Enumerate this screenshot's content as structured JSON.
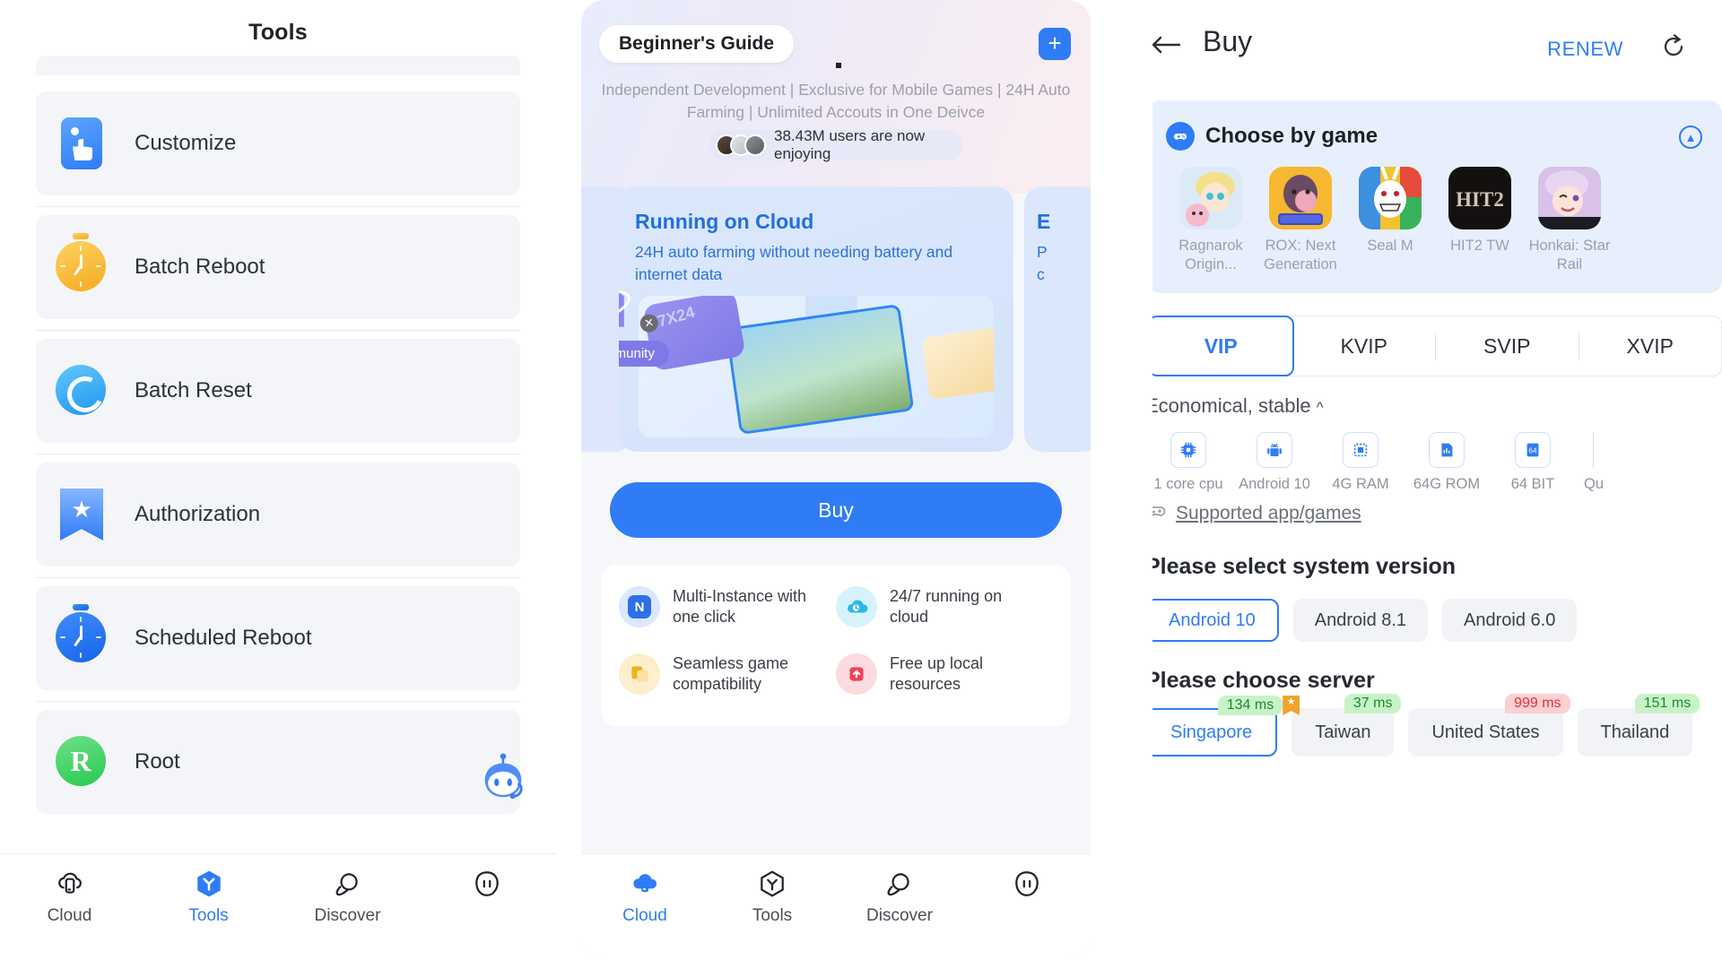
{
  "tools_panel": {
    "title": "Tools",
    "items": [
      {
        "label": "Customize",
        "icon": "customize-icon"
      },
      {
        "label": "Batch Reboot",
        "icon": "stopwatch-amber-icon"
      },
      {
        "label": "Batch Reset",
        "icon": "refresh-circle-icon"
      },
      {
        "label": "Authorization",
        "icon": "bookmark-star-icon"
      },
      {
        "label": "Scheduled Reboot",
        "icon": "stopwatch-blue-icon"
      },
      {
        "label": "Root",
        "icon": "root-icon"
      }
    ],
    "assistant_icon": "robot-assistant-icon",
    "bottom_nav": [
      {
        "label": "Cloud",
        "icon": "cloud-phone-icon",
        "active": false
      },
      {
        "label": "Tools",
        "icon": "tools-hex-icon",
        "active": true
      },
      {
        "label": "Discover",
        "icon": "planet-icon",
        "active": false
      },
      {
        "label": "",
        "icon": "profile-icon",
        "active": false
      }
    ]
  },
  "cloud_panel": {
    "guide_pill": "Beginner's Guide",
    "add_button": "+",
    "subtitle": "Independent Development | Exclusive for Mobile Games | 24H Auto Farming | Unlimited Accouts in One Deivce",
    "users_text": "38.43M users are now enjoying",
    "carousel": [
      {
        "title": "Running on Cloud",
        "desc": "24H auto farming without needing battery and internet data",
        "badge": "7X24",
        "tag": "Community"
      },
      {
        "title": "E",
        "desc_line1": "P",
        "desc_line2": "c"
      }
    ],
    "buy_button": "Buy",
    "features": [
      {
        "text": "Multi-Instance with one click",
        "icon": "multi-instance-icon",
        "color": "#2f6fe8",
        "bg": "#dbe8fd"
      },
      {
        "text": "24/7 running on cloud",
        "icon": "cloud-running-icon",
        "color": "#2bb7e8",
        "bg": "#d6f3fb"
      },
      {
        "text": "Seamless game compatibility",
        "icon": "seamless-game-icon",
        "color": "#f0b11f",
        "bg": "#fdeecd"
      },
      {
        "text": "Free up local resources",
        "icon": "free-resources-icon",
        "color": "#f2415a",
        "bg": "#fcdbe0"
      }
    ],
    "bottom_nav": [
      {
        "label": "Cloud",
        "icon": "cloud-phone-icon",
        "active": true
      },
      {
        "label": "Tools",
        "icon": "tools-hex-icon",
        "active": false
      },
      {
        "label": "Discover",
        "icon": "planet-icon",
        "active": false
      },
      {
        "label": "",
        "icon": "profile-icon",
        "active": false
      }
    ]
  },
  "buy_panel": {
    "back_icon": "back-arrow-icon",
    "title": "Buy",
    "renew_label": "RENEW",
    "refresh_icon": "refresh-icon",
    "choose_by_game": {
      "icon": "gamepad-icon",
      "title": "Choose by game",
      "collapse_icon": "chevron-up-icon",
      "games": [
        {
          "name": "Ragnarok Origin...",
          "art": "ragnarok"
        },
        {
          "name": "ROX: Next Generation",
          "art": "rox"
        },
        {
          "name": "Seal M",
          "art": "sealm"
        },
        {
          "name": "HIT2 TW",
          "art": "hit2"
        },
        {
          "name": "Honkai: Star Rail",
          "art": "honkai"
        }
      ]
    },
    "vip_tabs": [
      {
        "label": "VIP",
        "selected": true
      },
      {
        "label": "KVIP",
        "selected": false
      },
      {
        "label": "SVIP",
        "selected": false
      },
      {
        "label": "XVIP",
        "selected": false
      }
    ],
    "econ_label": "Economical, stable",
    "econ_chevron": "^",
    "specs": [
      {
        "label": "1 core cpu",
        "icon": "cpu-icon"
      },
      {
        "label": "Android 10",
        "icon": "android-icon"
      },
      {
        "label": "4G RAM",
        "icon": "ram-icon"
      },
      {
        "label": "64G ROM",
        "icon": "rom-icon"
      },
      {
        "label": "64 BIT",
        "icon": "bit64-icon"
      },
      {
        "label": "Qu",
        "icon": "partial-icon"
      }
    ],
    "supported_link": "Supported app/games",
    "supported_icon": "gamepad-outline-icon",
    "system_version_title": "Please select system version",
    "system_versions": [
      {
        "label": "Android 10",
        "selected": true
      },
      {
        "label": "Android 8.1",
        "selected": false
      },
      {
        "label": "Android 6.0",
        "selected": false
      }
    ],
    "server_title": "Please choose server",
    "servers": [
      {
        "label": "Singapore",
        "latency": "134 ms",
        "status": "good",
        "selected": true,
        "starred": false
      },
      {
        "label": "Taiwan",
        "latency": "37 ms",
        "status": "good",
        "selected": false,
        "starred": true
      },
      {
        "label": "United States",
        "latency": "999 ms",
        "status": "bad",
        "selected": false,
        "starred": false
      },
      {
        "label": "Thailand",
        "latency": "151 ms",
        "status": "good",
        "selected": false,
        "starred": false
      }
    ]
  },
  "colors": {
    "accent": "#2f7cf6",
    "good": "#1a8c2e",
    "bad": "#e0303c",
    "muted": "#9ba0aa"
  }
}
